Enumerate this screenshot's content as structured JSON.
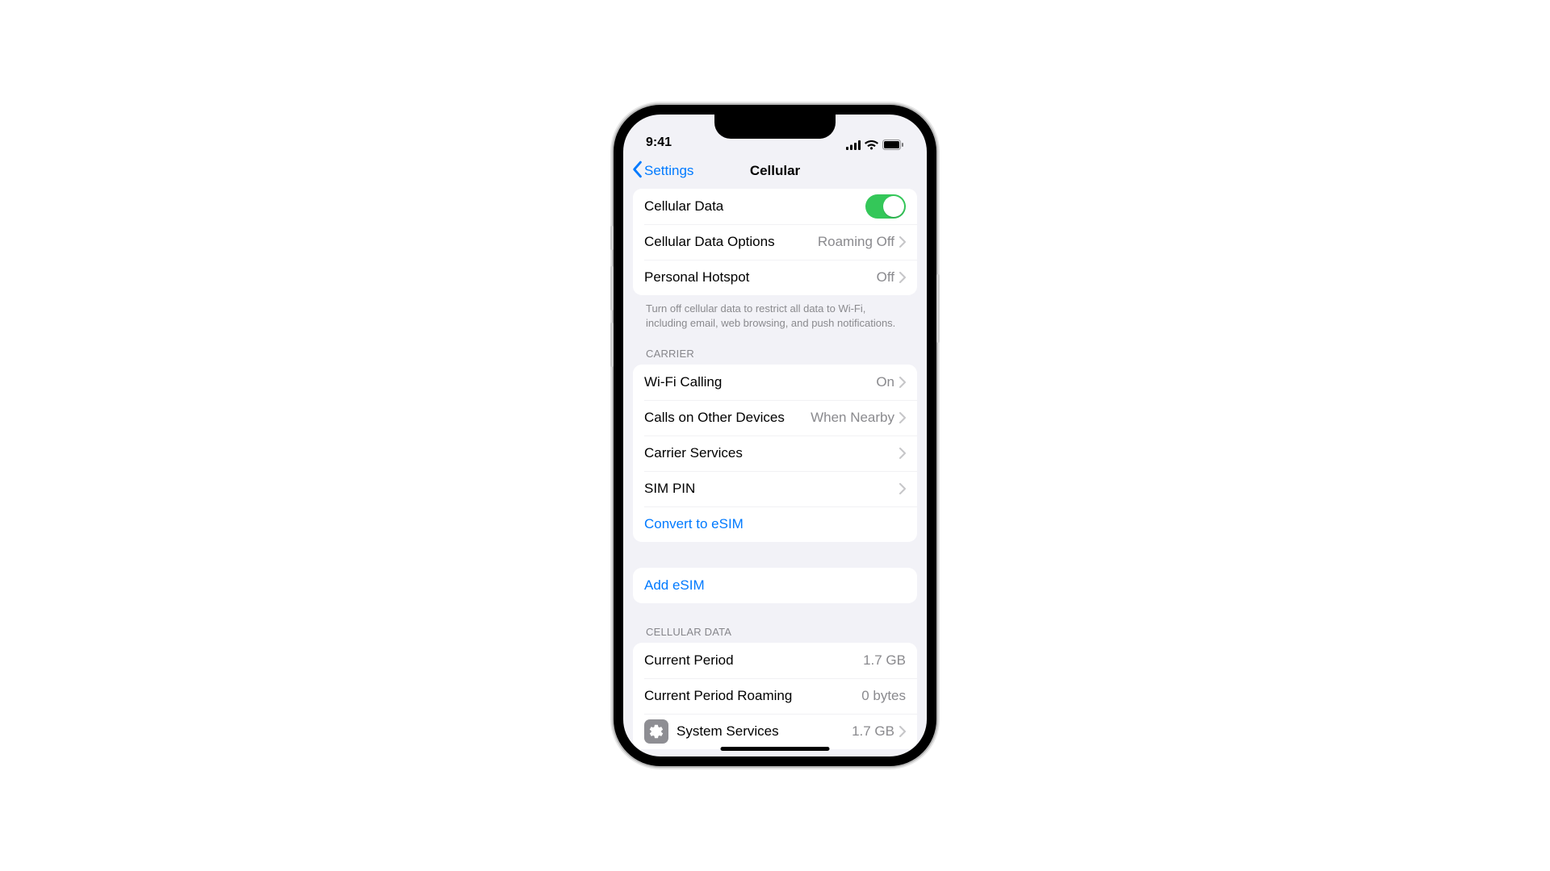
{
  "status": {
    "time": "9:41"
  },
  "nav": {
    "back_label": "Settings",
    "title": "Cellular"
  },
  "section1": {
    "cellular_data": "Cellular Data",
    "data_options": "Cellular Data Options",
    "data_options_value": "Roaming Off",
    "personal_hotspot": "Personal Hotspot",
    "personal_hotspot_value": "Off",
    "footer": "Turn off cellular data to restrict all data to Wi-Fi, including email, web browsing, and push notifications."
  },
  "carrier": {
    "header": "CARRIER",
    "wifi_calling": "Wi-Fi Calling",
    "wifi_calling_value": "On",
    "calls_other": "Calls on Other Devices",
    "calls_other_value": "When Nearby",
    "carrier_services": "Carrier Services",
    "sim_pin": "SIM PIN",
    "convert_esim": "Convert to eSIM"
  },
  "esim": {
    "add": "Add eSIM"
  },
  "usage": {
    "header": "CELLULAR DATA",
    "current_period": "Current Period",
    "current_period_value": "1.7 GB",
    "current_roaming": "Current Period Roaming",
    "current_roaming_value": "0 bytes",
    "system_services": "System Services",
    "system_services_value": "1.7 GB"
  }
}
